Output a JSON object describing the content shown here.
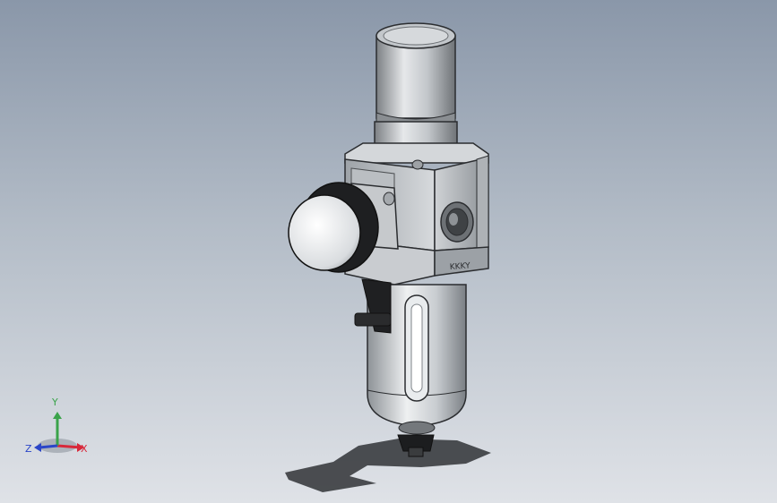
{
  "viewport": {
    "background_top": "#8a97a9",
    "background_bottom": "#dfe2e7"
  },
  "model": {
    "component": "filter-regulator-with-gauge",
    "body_marking": "KKKY"
  },
  "triad": {
    "x_label": "X",
    "y_label": "Y",
    "z_label": "Z",
    "x_color": "#d8283a",
    "y_color": "#3aa34a",
    "z_color": "#2a45c8"
  }
}
